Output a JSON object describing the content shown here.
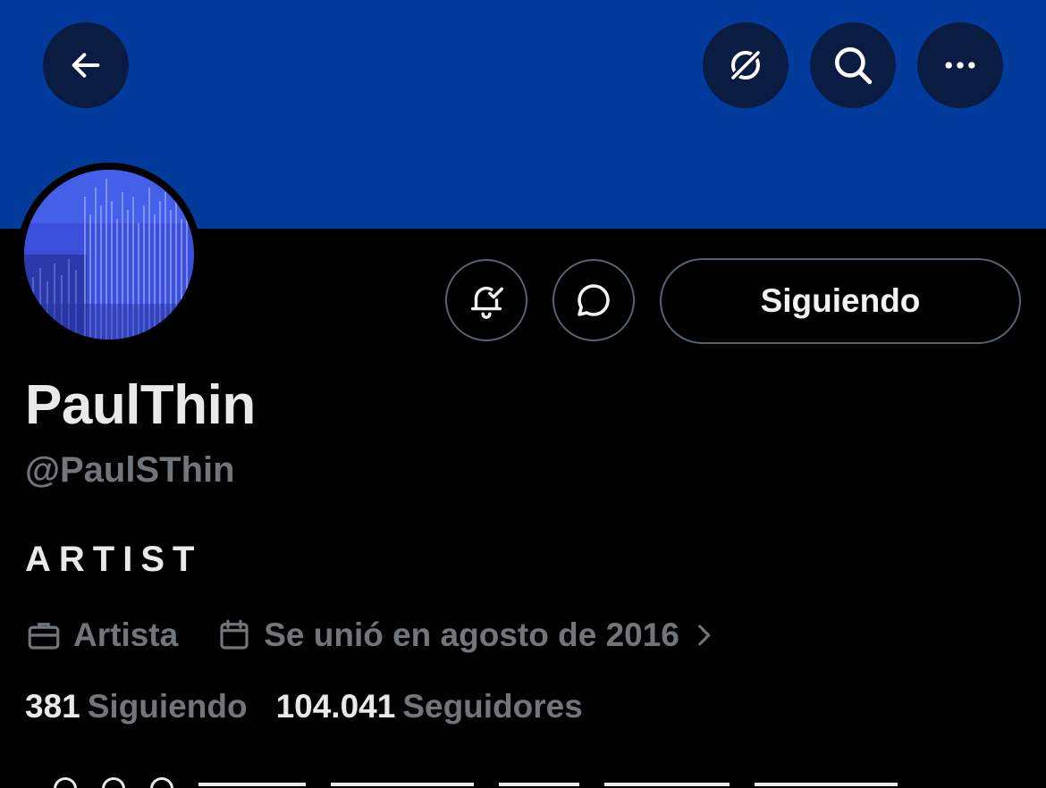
{
  "header": {
    "back_icon": "arrow-left-icon",
    "grok_icon": "grok-icon",
    "search_icon": "search-icon",
    "more_icon": "more-horizontal-icon",
    "banner_color": "#023b9b"
  },
  "actions": {
    "notify_icon": "bell-check-icon",
    "message_icon": "message-bubble-icon",
    "follow_label": "Siguiendo"
  },
  "profile": {
    "display_name": "PaulThin",
    "handle": "@PaulSThin",
    "bio": "ARTIST",
    "category": "Artista",
    "joined": "Se unió en agosto de 2016",
    "following_count": "381",
    "following_label": "Siguiendo",
    "followers_count": "104.041",
    "followers_label": "Seguidores"
  },
  "colors": {
    "background": "#000000",
    "muted_text": "#71767b",
    "border": "#536471"
  }
}
